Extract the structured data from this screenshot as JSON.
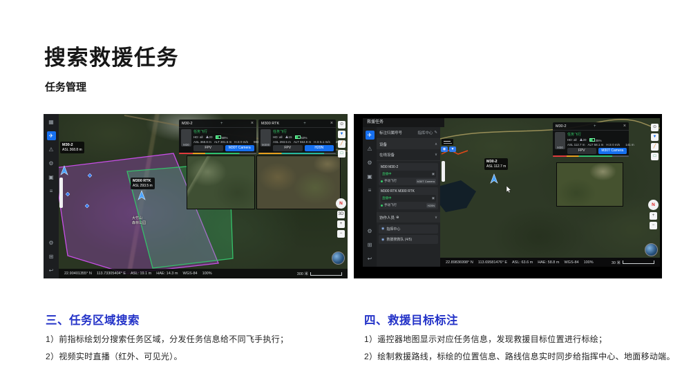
{
  "page": {
    "title": "搜索救援任务",
    "subtitle": "任务管理"
  },
  "icons": {
    "close": "×",
    "move": "+",
    "chevron_up": "∧",
    "chevron_down": "∨",
    "pencil": "✎",
    "plus_circle": "⊕",
    "person": "◉",
    "compass_n": "N",
    "threed": "3D",
    "zoom_in": "+",
    "zoom_out": "−",
    "rail": [
      "▦",
      "✈",
      "⚠",
      "⚙",
      "▣",
      "≡"
    ],
    "rail_bottom": [
      "⚙",
      "⊞",
      "↩"
    ],
    "tools": [
      "⊙",
      "▼",
      "╱",
      "□"
    ]
  },
  "colors": {
    "accent_blue": "#1670f0",
    "polygon_purple": "#c94fe8",
    "polygon_green": "#35c06a",
    "status_green": "#35d06a",
    "route_orange": "#e04818",
    "caption_blue": "#2433c8"
  },
  "left_app": {
    "panels": [
      {
        "name": "M30-2",
        "model": "M30",
        "status": "任务飞行",
        "hd": "HD: all",
        "sats": "20",
        "battery": "58%",
        "asl": "ASL 368.8 m",
        "alt": "ALT 301.5 m",
        "hs": "H.S 0 m/s",
        "dist": "983 m",
        "fpv": "FPV",
        "camera": "M30T Camera"
      },
      {
        "name": "M300 RTK",
        "model": "M300",
        "status": "任务飞行",
        "hd": "HD: all",
        "sats": "15",
        "battery": "53%",
        "asl": "ASL 293.5 m",
        "alt": "ALT 553.9 m",
        "hs": "H.S 5.1 m/s",
        "dist": "2953 m",
        "fpv": "FPV",
        "camera": "H20N"
      }
    ],
    "markers": [
      {
        "name": "M30-2",
        "alt": "ASL 368.8 m"
      },
      {
        "name": "M300 RTK",
        "alt": "ASL 293.5 m"
      }
    ],
    "place": {
      "line1": "大竹山",
      "line2": "森林公园"
    },
    "status_bar": {
      "lat": "22.90401355° N",
      "lon": "113.73305404° E",
      "asl": "ASL: 19.1 m",
      "hae": "HAE: 14.3 m",
      "datum": "WGS-84",
      "battery": "100%",
      "scale": "300 米"
    }
  },
  "right_app": {
    "window_title": "救援任务",
    "sidebar": {
      "callsign_label": "标注归属呼号",
      "callsign_value": "指挥中心",
      "devices_section": "设备",
      "online_label": "在线设备",
      "cards": [
        {
          "title": "M30 M30-2",
          "live": "直播中",
          "status": "手动飞行",
          "camera": "M30T Camera"
        },
        {
          "title": "M300 RTK M300 RTK",
          "live": "直播中",
          "status": "手动飞行",
          "camera": "H20N"
        }
      ],
      "members_section": "协作人员",
      "members": [
        "指挥中心",
        "救援搜救队 (4/5)"
      ]
    },
    "panel": {
      "name": "M30-2",
      "model": "M30",
      "status": "任务飞行",
      "hd": "HD: all",
      "sats": "20",
      "battery": "35%",
      "asl": "ASL 112.7 m",
      "alt": "ALT 58.1 m",
      "hs": "H.S 0 m/s",
      "dist": "141 m",
      "fpv": "FPV",
      "camera": "M30T Camera"
    },
    "marker": {
      "name": "M30-2",
      "alt": "ASL 112.7 m"
    },
    "status_bar": {
      "lat": "22.89836998° N",
      "lon": "113.69581476° E",
      "asl": "ASL: 63.6 m",
      "hae": "HAE: 58.8 m",
      "datum": "WGS-84",
      "battery": "100%",
      "scale": "30 米"
    }
  },
  "captions": {
    "left": {
      "heading": "三、任务区域搜索",
      "line1": "1）前指标绘划分搜索任务区域，分发任务信息给不同飞手执行；",
      "line2": "2）视频实时直播（红外、可见光）。"
    },
    "right": {
      "heading": "四、救援目标标注",
      "line1": "1）遥控器地图显示对应任务信息，发现救援目标位置进行标绘；",
      "line2": "2）绘制救援路线，标绘的位置信息、路线信息实时同步给指挥中心、地面移动端。"
    }
  }
}
